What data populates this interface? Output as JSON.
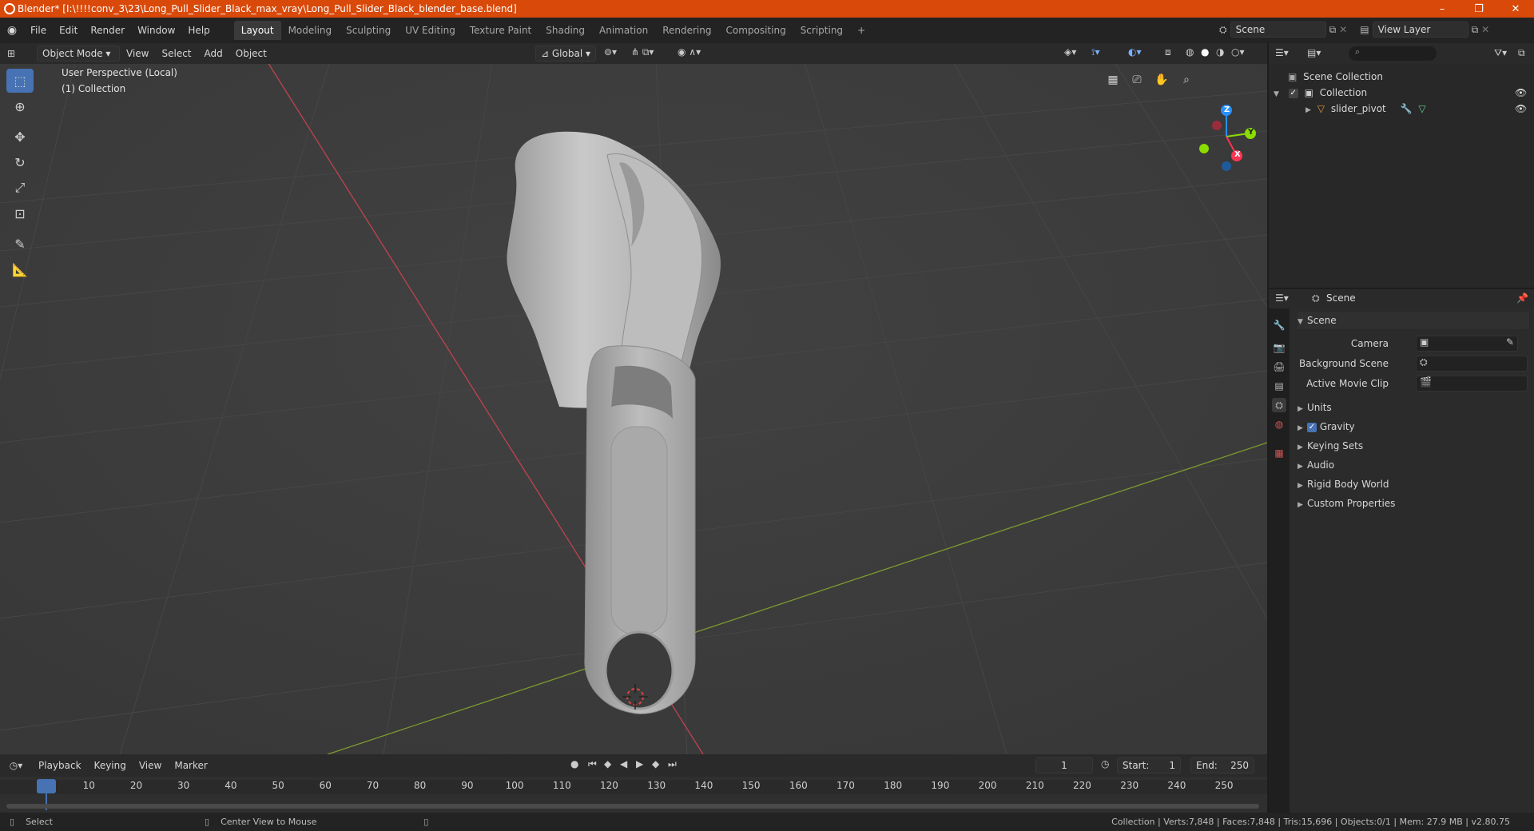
{
  "window": {
    "title": "Blender* [I:\\!!!!conv_3\\23\\Long_Pull_Slider_Black_max_vray\\Long_Pull_Slider_Black_blender_base.blend]",
    "minimize": "–",
    "maximize": "❐",
    "close": "✕"
  },
  "menu": {
    "items": [
      "File",
      "Edit",
      "Render",
      "Window",
      "Help"
    ]
  },
  "workspaces": {
    "tabs": [
      "Layout",
      "Modeling",
      "Sculpting",
      "UV Editing",
      "Texture Paint",
      "Shading",
      "Animation",
      "Rendering",
      "Compositing",
      "Scripting"
    ],
    "active": "Layout",
    "add": "+"
  },
  "scene_selector": {
    "value": "Scene"
  },
  "view_layer_selector": {
    "value": "View Layer"
  },
  "viewport_header": {
    "mode": "Object Mode",
    "menus": [
      "View",
      "Select",
      "Add",
      "Object"
    ],
    "orientation": "Global"
  },
  "viewport": {
    "perspective_label": "User Perspective (Local)",
    "collection_label": "(1) Collection",
    "gizmo_axes": {
      "z": "Z",
      "y": "Y",
      "x": "X"
    }
  },
  "outliner": {
    "search_placeholder": "",
    "rows": [
      {
        "label": "Scene Collection"
      },
      {
        "label": "Collection"
      },
      {
        "label": "slider_pivot"
      }
    ]
  },
  "properties": {
    "header": "Scene",
    "panel_title": "Scene",
    "fields": [
      {
        "label": "Camera"
      },
      {
        "label": "Background Scene"
      },
      {
        "label": "Active Movie Clip"
      }
    ],
    "sections": [
      "Units",
      "Gravity",
      "Keying Sets",
      "Audio",
      "Rigid Body World",
      "Custom Properties"
    ],
    "gravity_checked": true
  },
  "timeline": {
    "menus": [
      "Playback",
      "Keying",
      "View",
      "Marker"
    ],
    "current_frame": "1",
    "start_label": "Start:",
    "start": "1",
    "end_label": "End:",
    "end": "250",
    "ticks": [
      "1",
      "10",
      "20",
      "30",
      "40",
      "50",
      "60",
      "70",
      "80",
      "90",
      "100",
      "110",
      "120",
      "130",
      "140",
      "150",
      "160",
      "170",
      "180",
      "190",
      "200",
      "210",
      "220",
      "230",
      "240",
      "250"
    ]
  },
  "statusbar": {
    "left_action": "Select",
    "middle_action": "Center View to Mouse",
    "stats": "Collection | Verts:7,848 | Faces:7,848 | Tris:15,696 | Objects:0/1 | Mem: 27.9 MB | v2.80.75"
  },
  "colors": {
    "titlebar": "#d9490a",
    "accent": "#4772b3",
    "axis_x": "#ff3352",
    "axis_y": "#8bdc00",
    "axis_z": "#2890ff"
  }
}
